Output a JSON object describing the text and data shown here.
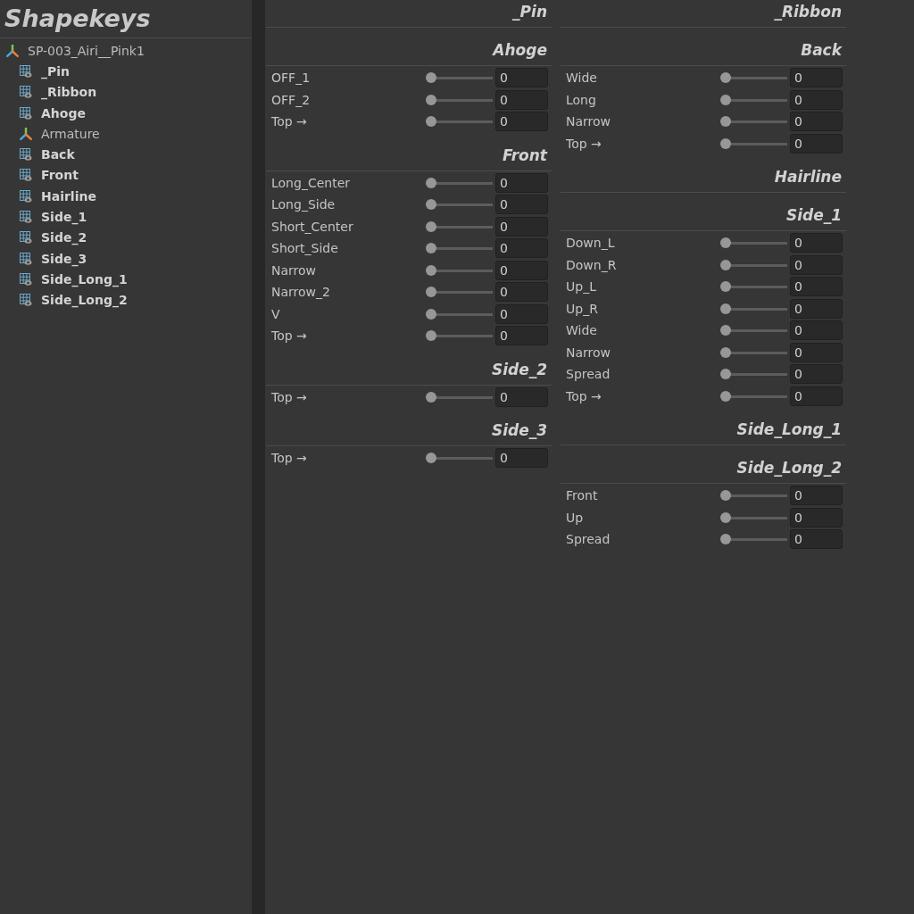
{
  "panel": {
    "title": "Shapekeys"
  },
  "tree": {
    "label": "SP-003_Airi__Pink1",
    "kind": "armature",
    "children": [
      {
        "label": "_Pin",
        "kind": "mesh"
      },
      {
        "label": "_Ribbon",
        "kind": "mesh"
      },
      {
        "label": "Ahoge",
        "kind": "mesh"
      },
      {
        "label": "Armature",
        "kind": "armature"
      },
      {
        "label": "Back",
        "kind": "mesh"
      },
      {
        "label": "Front",
        "kind": "mesh"
      },
      {
        "label": "Hairline",
        "kind": "mesh"
      },
      {
        "label": "Side_1",
        "kind": "mesh"
      },
      {
        "label": "Side_2",
        "kind": "mesh"
      },
      {
        "label": "Side_3",
        "kind": "mesh"
      },
      {
        "label": "Side_Long_1",
        "kind": "mesh"
      },
      {
        "label": "Side_Long_2",
        "kind": "mesh"
      }
    ]
  },
  "columns": [
    {
      "sections": [
        {
          "title": "_Pin"
        },
        {
          "title": "Ahoge",
          "sliders": [
            {
              "label": "OFF_1",
              "level": 0,
              "value": "0"
            },
            {
              "label": "OFF_2",
              "level": 0,
              "value": "0"
            },
            {
              "label": "Top →",
              "level": 0,
              "value": "0"
            }
          ]
        },
        {
          "title": "Front",
          "sliders": [
            {
              "label": "Long_Center",
              "level": 0,
              "value": "0"
            },
            {
              "label": "Long_Side",
              "level": 0,
              "value": "0"
            },
            {
              "label": "Short_Center",
              "level": 0,
              "value": "0"
            },
            {
              "label": "Short_Side",
              "level": 0,
              "value": "0"
            },
            {
              "label": "Narrow",
              "level": 0,
              "value": "0"
            },
            {
              "label": "Narrow_2",
              "level": 0,
              "value": "0"
            },
            {
              "label": "V",
              "level": 0,
              "value": "0"
            },
            {
              "label": "Top →",
              "level": 0,
              "value": "0"
            }
          ]
        },
        {
          "title": "Side_2",
          "sliders": [
            {
              "label": "Top →",
              "level": 0,
              "value": "0"
            }
          ]
        },
        {
          "title": "Side_3",
          "sliders": [
            {
              "label": "Top →",
              "level": 0,
              "value": "0"
            }
          ]
        }
      ]
    },
    {
      "sections": [
        {
          "title": "_Ribbon"
        },
        {
          "title": "Back",
          "sliders": [
            {
              "label": "Wide",
              "level": 0,
              "value": "0"
            },
            {
              "label": "Long",
              "level": 0,
              "value": "0"
            },
            {
              "label": "Narrow",
              "level": 0,
              "value": "0"
            },
            {
              "label": "Top →",
              "level": 0,
              "value": "0"
            }
          ]
        },
        {
          "title": "Hairline"
        },
        {
          "title": "Side_1",
          "sliders": [
            {
              "label": "Down_L",
              "level": 0,
              "value": "0"
            },
            {
              "label": "Down_R",
              "level": 0,
              "value": "0"
            },
            {
              "label": "Up_L",
              "level": 0,
              "value": "0"
            },
            {
              "label": "Up_R",
              "level": 0,
              "value": "0"
            },
            {
              "label": "Wide",
              "level": 0,
              "value": "0"
            },
            {
              "label": "Narrow",
              "level": 0,
              "value": "0"
            },
            {
              "label": "Spread",
              "level": 0,
              "value": "0"
            },
            {
              "label": "Top →",
              "level": 0,
              "value": "0"
            }
          ]
        },
        {
          "title": "Side_Long_1"
        },
        {
          "title": "Side_Long_2",
          "sliders": [
            {
              "label": "Front",
              "level": 0,
              "value": "0"
            },
            {
              "label": "Up",
              "level": 0,
              "value": "0"
            },
            {
              "label": "Spread",
              "level": 0,
              "value": "0"
            }
          ]
        }
      ]
    }
  ]
}
